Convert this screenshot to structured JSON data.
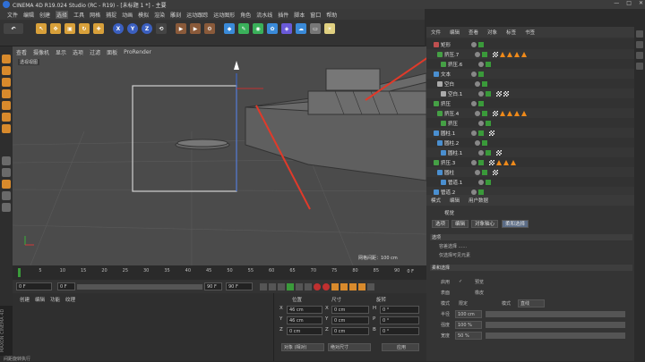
{
  "window": {
    "title": "CINEMA 4D R19.024 Studio (RC - R19) - [未标题 1 *] - 主要",
    "controls": [
      "—",
      "□",
      "✕"
    ]
  },
  "menu": [
    "文件",
    "编辑",
    "创建",
    "选择",
    "工具",
    "网格",
    "捕捉",
    "动画",
    "模拟",
    "渲染",
    "雕刻",
    "运动跟踪",
    "运动图形",
    "角色",
    "流水线",
    "插件",
    "脚本",
    "窗口",
    "帮助"
  ],
  "menu_highlight": "选择",
  "toolbar": {
    "axes": [
      "X",
      "Y",
      "Z"
    ]
  },
  "viewport": {
    "menu": [
      "查看",
      "摄像机",
      "显示",
      "选项",
      "过滤",
      "面板",
      "ProRender"
    ],
    "label": "透视视图",
    "grid_info": "网格间距：100 cm"
  },
  "timeline": {
    "ticks": [
      "0",
      "5",
      "10",
      "15",
      "20",
      "25",
      "30",
      "35",
      "40",
      "45",
      "50",
      "55",
      "60",
      "65",
      "70",
      "75",
      "80",
      "85",
      "90"
    ],
    "end_label": "0 F",
    "start_field": "0 F",
    "current_field": "0 F",
    "end_field1": "90 F",
    "end_field2": "90 F"
  },
  "material_panel": {
    "tabs": [
      "创建",
      "编辑",
      "功能",
      "纹理"
    ]
  },
  "coords": {
    "headers": [
      "位置",
      "尺寸",
      "旋转"
    ],
    "rows": [
      {
        "axis": "X",
        "pos": "46 cm",
        "size": "0 cm",
        "rot_axis": "H",
        "rot": "0 °"
      },
      {
        "axis": "Y",
        "pos": "46 cm",
        "size": "0 cm",
        "rot_axis": "P",
        "rot": "0 °"
      },
      {
        "axis": "Z",
        "pos": "0 cm",
        "size": "0 cm",
        "rot_axis": "B",
        "rot": "0 °"
      }
    ],
    "mode_select": "对象 (相对)",
    "size_select": "绝对尺寸",
    "apply": "应用"
  },
  "side_brand": "MAXON CINEMA 4D",
  "status": "间距旋转执行",
  "object_manager": {
    "tabs": [
      "文件",
      "编辑",
      "查看",
      "对象",
      "标签",
      "书签"
    ],
    "rows": [
      {
        "name": "矩形",
        "icon_color": "#c05050",
        "tags": ""
      },
      {
        "name": "挤压.7",
        "icon_color": "#45a045",
        "tags": "full"
      },
      {
        "name": "挤压.6",
        "icon_color": "#45a045",
        "tags": "none"
      },
      {
        "name": "文本",
        "icon_color": "#4a8fd0",
        "tags": "none"
      },
      {
        "name": "空白",
        "icon_color": "#aaaaaa",
        "tags": "none"
      },
      {
        "name": "空白.1",
        "icon_color": "#aaaaaa",
        "tags": "two"
      },
      {
        "name": "挤压",
        "icon_color": "#45a045",
        "tags": "none"
      },
      {
        "name": "挤压.4",
        "icon_color": "#45a045",
        "tags": "full"
      },
      {
        "name": "挤压",
        "icon_color": "#45a045",
        "tags": "none"
      },
      {
        "name": "圆柱.1",
        "icon_color": "#4a8fd0",
        "tags": "one"
      },
      {
        "name": "圆柱.2",
        "icon_color": "#4a8fd0",
        "tags": "none"
      },
      {
        "name": "圆柱.1",
        "icon_color": "#4a8fd0",
        "tags": "one"
      },
      {
        "name": "挤压.3",
        "icon_color": "#45a045",
        "tags": "three"
      },
      {
        "name": "圆柱",
        "icon_color": "#4a8fd0",
        "tags": "one"
      },
      {
        "name": "管道.1",
        "icon_color": "#4a8fd0",
        "tags": "none"
      },
      {
        "name": "管道.2",
        "icon_color": "#4a8fd0",
        "tags": "none"
      }
    ]
  },
  "attribute_manager": {
    "tabs": [
      "模式",
      "编辑",
      "用户数据"
    ],
    "title": "视觉",
    "buttons": [
      "选项",
      "编辑",
      "对象轴心",
      "柔和选择"
    ],
    "selected_button": "柔和选择",
    "section1": "选项",
    "opt1": "容差选择 ......",
    "opt2": "仅选择可见元素",
    "section2": "柔和选择",
    "rows": [
      {
        "label": "启用",
        "value": "✓"
      },
      {
        "label": "表面",
        "value": ""
      },
      {
        "label": "模式",
        "value": "限定"
      },
      {
        "label": "半径",
        "value": "100 cm"
      },
      {
        "label": "强度",
        "value": "100 %"
      },
      {
        "label": "宽度",
        "value": "50 %"
      }
    ],
    "preview_label": "预览",
    "rubber_label": "橡皮",
    "mode_label": "模式",
    "mode_value": "直线"
  }
}
